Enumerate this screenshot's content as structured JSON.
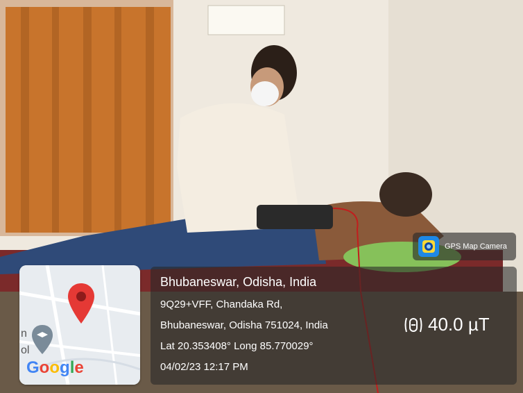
{
  "app": {
    "name": "GPS Map Camera"
  },
  "map": {
    "brand": "Google",
    "brand_letters": [
      "G",
      "o",
      "o",
      "g",
      "l",
      "e"
    ],
    "brand_colors": [
      "#4285F4",
      "#EA4335",
      "#FBBC05",
      "#4285F4",
      "#34A853",
      "#EA4335"
    ],
    "pin_color": "#E53935",
    "edge_text_top": "n",
    "edge_text_bottom": "ol"
  },
  "location": {
    "title": "Bhubaneswar, Odisha, India",
    "line1": "9Q29+VFF, Chandaka Rd,",
    "line2": "Bhubaneswar, Odisha 751024, India",
    "coords": "Lat 20.353408° Long 85.770029°",
    "datetime": "04/02/23 12:17 PM"
  },
  "sensor": {
    "icon": "magnetometer-icon",
    "value": "40.0 µT"
  },
  "colors": {
    "panel_bg": "rgba(40,40,40,0.58)",
    "curtain": "#c8742c",
    "wall": "#efe9df",
    "coat": "#f4ede1",
    "mask": "#f5f5f5",
    "jeans": "#2f4a78",
    "pillow": "#86c15a",
    "bed": "#7b2a2a",
    "skin": "#8a5a3a"
  }
}
